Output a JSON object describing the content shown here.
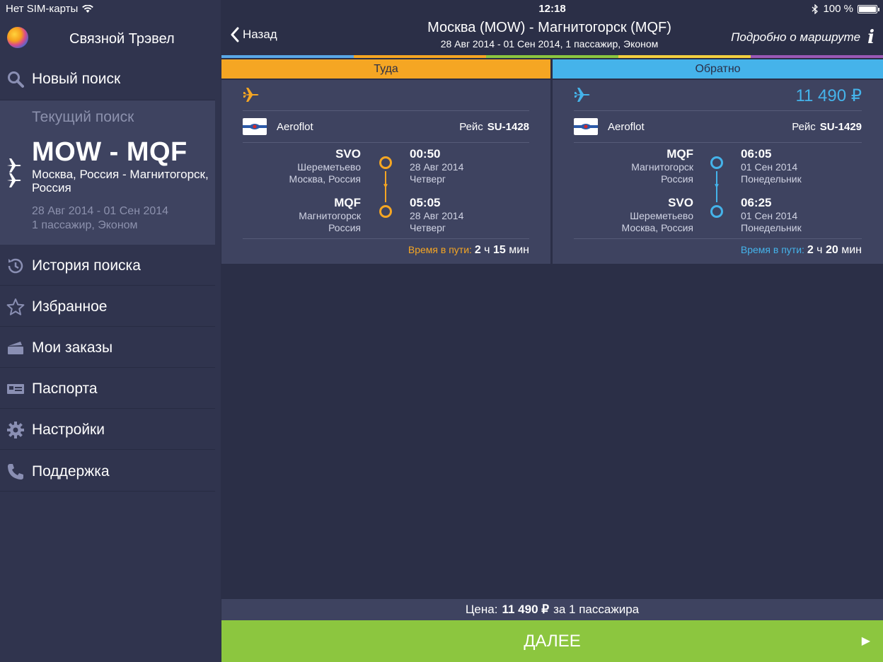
{
  "status_bar": {
    "carrier": "Нет SIM-карты",
    "time": "12:18",
    "battery": "100 %"
  },
  "sidebar": {
    "app_title": "Связной Трэвел",
    "new_search": "Новый поиск",
    "current_search": {
      "heading": "Текущий поиск",
      "route": "MOW - MQF",
      "cities": "Москва, Россия - Магнитогорск, Россия",
      "dates": "28 Авг 2014 - 01 Сен 2014",
      "passengers": "1 пассажир, Эконом"
    },
    "items": [
      {
        "label": "История поиска",
        "icon": "history-icon"
      },
      {
        "label": "Избранное",
        "icon": "star-icon"
      },
      {
        "label": "Мои заказы",
        "icon": "tickets-icon"
      },
      {
        "label": "Паспорта",
        "icon": "passport-icon"
      },
      {
        "label": "Настройки",
        "icon": "gear-icon"
      },
      {
        "label": "Поддержка",
        "icon": "phone-icon"
      }
    ]
  },
  "header": {
    "back": "Назад",
    "title": "Москва (MOW) - Магнитогорск (MQF)",
    "subtitle": "28 Авг 2014 - 01 Сен 2014, 1 пассажир, Эконом",
    "route_details": "Подробно о маршруте"
  },
  "tabs": {
    "outbound": "Туда",
    "return": "Обратно"
  },
  "outbound": {
    "airline": "Aeroflot",
    "flight_label": "Рейс",
    "flight_no": "SU-1428",
    "dep": {
      "code": "SVO",
      "airport": "Шереметьево",
      "city": "Москва, Россия",
      "time": "00:50",
      "date": "28 Авг 2014",
      "day": "Четверг"
    },
    "arr": {
      "code": "MQF",
      "airport": "Магнитогорск",
      "city": "Россия",
      "time": "05:05",
      "date": "28 Авг 2014",
      "day": "Четверг"
    },
    "duration_label": "Время в пути:",
    "duration_h": "2",
    "duration_h_unit": "ч",
    "duration_m": "15",
    "duration_m_unit": "мин",
    "color": "#f5a623"
  },
  "return": {
    "price": "11 490 ₽",
    "airline": "Aeroflot",
    "flight_label": "Рейс",
    "flight_no": "SU-1429",
    "dep": {
      "code": "MQF",
      "airport": "Магнитогорск",
      "city": "Россия",
      "time": "06:05",
      "date": "01 Сен 2014",
      "day": "Понедельник"
    },
    "arr": {
      "code": "SVO",
      "airport": "Шереметьево",
      "city": "Москва, Россия",
      "time": "06:25",
      "date": "01 Сен 2014",
      "day": "Понедельник"
    },
    "duration_label": "Время в пути:",
    "duration_h": "2",
    "duration_h_unit": "ч",
    "duration_m": "20",
    "duration_m_unit": "мин",
    "color": "#45b3ea"
  },
  "footer": {
    "price_label": "Цена:",
    "price_value": "11 490 ₽",
    "price_suffix": "за 1 пассажира",
    "next": "ДАЛЕЕ"
  }
}
